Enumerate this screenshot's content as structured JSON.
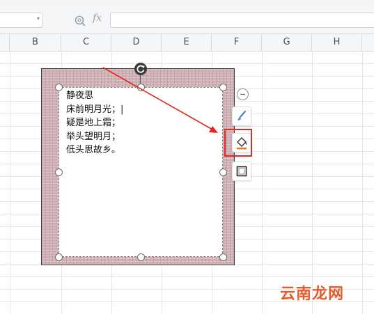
{
  "formula_bar": {
    "fx_label": "fx",
    "name_box_value": "",
    "formula_value": ""
  },
  "columns": [
    "B",
    "C",
    "D",
    "E",
    "F",
    "G",
    "H"
  ],
  "textbox": {
    "lines": [
      "静夜思",
      "床前明月光；|",
      "疑是地上霜；",
      "举头望明月；",
      "低头思故乡。"
    ]
  },
  "float_toolbar": {
    "items": [
      {
        "name": "collapse",
        "icon": "minus-circle-icon"
      },
      {
        "name": "shape-style",
        "icon": "brush-icon"
      },
      {
        "name": "shape-fill",
        "icon": "fill-bucket-icon",
        "highlighted": true
      },
      {
        "name": "shape-outline",
        "icon": "square-outline-icon"
      }
    ]
  },
  "colors": {
    "highlight": "#e8251c",
    "arrow": "#e8251c",
    "fill_swatch": "#e8731c",
    "shape_fill": "#cfb1b5"
  },
  "watermark": "云南龙网"
}
